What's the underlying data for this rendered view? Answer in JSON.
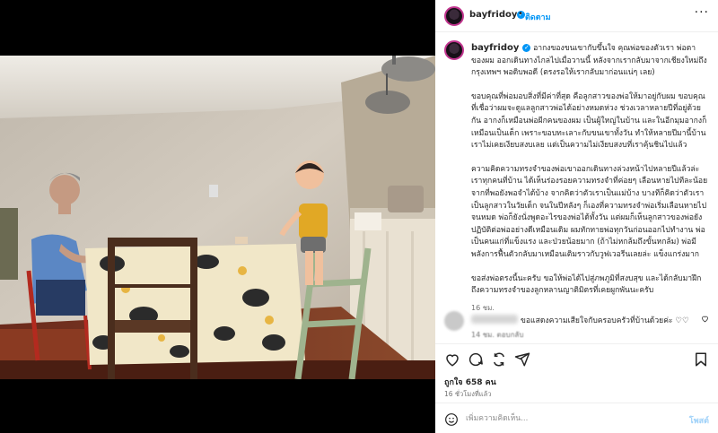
{
  "post": {
    "username": "bayfridoy",
    "follow_label": "ติดตาม",
    "dot": "•",
    "more": "···"
  },
  "caption": {
    "username": "bayfridoy",
    "paragraphs": [
      "อากงของขนเขากับขึ้นใจ คุณพ่อของตัวเรา พ่อตาของผม ออกเดินทางไกลไปเมื่อวานนี้ หลังจากเรากลับมาจากเชียงใหม่ถึงกรุงเทพฯ พอดิบพอดี (ตรงรอให้เรากลับมาก่อนแน่ๆ เลย)",
      "ขอบคุณที่พ่อมอบสิ่งที่มีค่าที่สุด คือลูกสาวของพ่อให้มาอยู่กับผม ขอบคุณที่เชื่อว่าผมจะดูแลลูกสาวพ่อได้อย่างหมดห่วง ช่วงเวลาหลายปีที่อยู่ด้วยกัน อากงก็เหมือนพ่อผีกคนของผม เป็นผู้ใหญ่ในบ้าน และในอีกมุมอากงก็เหมือนเป็นเด็ก เพราะขอบทะเลาะกับขนเขาทั้งวัน ทำให้หลายปีมานี้บ้านเราไม่เคยเงียบสงบเลย แต่เป็นความไม่เงียบสงบที่เราคุ้นชินไปแล้ว",
      "ความคิดความทรงจำของพ่อเขาออกเดินทางล่วงหน้าไปหลายปีแล้วล่ะ เราทุกคนที่บ้าน ได้เห็นร่องรอยความทรงจำที่ค่อยๆ เลือนหายไปทีละน้อย จากที่พอยังพอจำได้บ้าง จากคิดว่าตัวเราเป็นแม่บ้าง บางทีก็คิดว่าตัวเราเป็นลูกสาวในวัยเด็ก จนในปีหลังๆ ก็เองที่ความทรงจำพ่อเริ่มเลือนหายไปจนหมด พ่อก็ยังนั่งพูดอะไรของพ่อได้ทั้งวัน แต่ผมก็เห็นลูกสาวของพ่อยังปฏิบัติต่อพ่ออย่างดีเหมือนเดิม ผมทักทายพ่อทุกวันก่อนออกไปทำงาน พ่อเป็นคนแก่ที่แข็งแรง และป่วยน้อยมาก (ถ้าไม่หกล้มถึงขั้นหกล้ม) พ่อมีพลังการฟื้นตัวกลับมาเหมือนเติมราวกับวูฟเวอรีนเลยล่ะ แข็งแกร่งมาก",
      "ขอส่งพ่อตรงนี้นะครับ ขอให้พ่อได้ไปสู่ภพภูมิที่สงบสุข และได้กลับมาฝึกถึงความทรงจำของลูกหลานญาติมิตรที่เคยผูกพันนะครับ"
    ],
    "time": "16 ชม."
  },
  "comment": {
    "text": "ขอแสดงความเสียใจกับครอบครัวที่บ้านด้วยค่ะ ♡♡",
    "meta": "14 ชม.   ตอบกลับ"
  },
  "stats": {
    "likes": "ถูกใจ 658 คน",
    "time_ago": "16 ชั่วโมงที่แล้ว"
  },
  "composer": {
    "placeholder": "เพิ่มความคิดเห็น...",
    "post_label": "โพสต์"
  },
  "icons": [
    "heart-icon",
    "comment-icon",
    "repost-icon",
    "share-icon",
    "bookmark-icon",
    "emoji-icon",
    "verified-badge-icon",
    "more-options-icon"
  ],
  "colors": {
    "accent": "#0095f6",
    "post_disabled": "#9ed1f9",
    "text": "#262626",
    "muted": "#737373"
  }
}
